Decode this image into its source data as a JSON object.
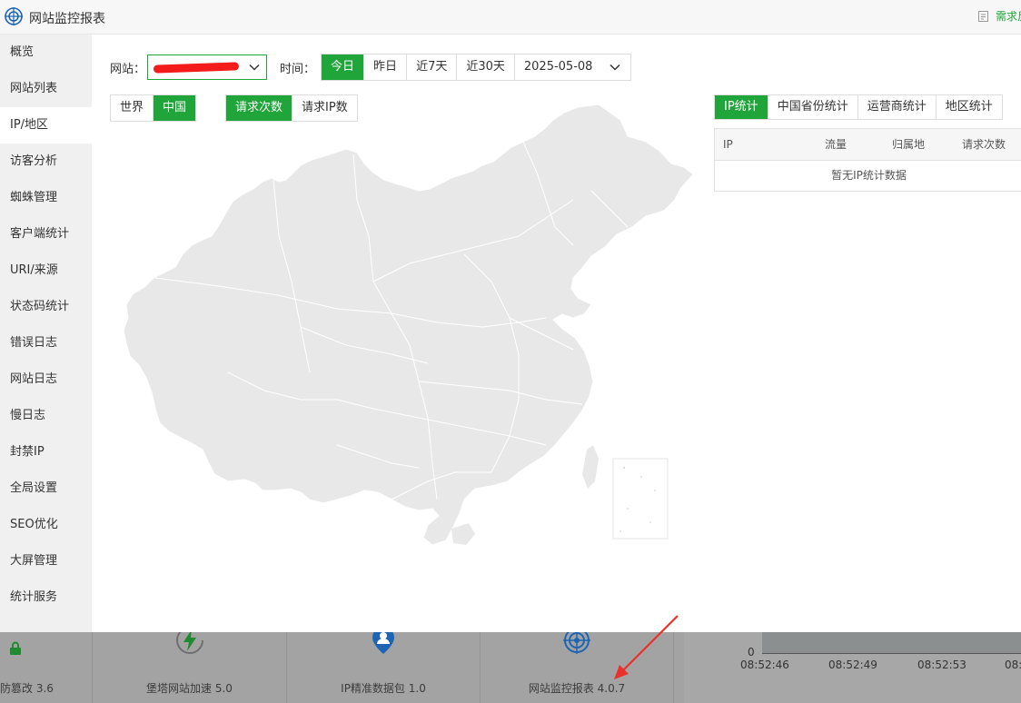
{
  "app": {
    "title": "网站监控报表",
    "request_link": "需求反"
  },
  "sidebar": {
    "items": [
      {
        "label": "概览"
      },
      {
        "label": "网站列表"
      },
      {
        "label": "IP/地区",
        "active": true
      },
      {
        "label": "访客分析"
      },
      {
        "label": "蜘蛛管理"
      },
      {
        "label": "客户端统计"
      },
      {
        "label": "URI/来源"
      },
      {
        "label": "状态码统计"
      },
      {
        "label": "错误日志"
      },
      {
        "label": "网站日志"
      },
      {
        "label": "慢日志"
      },
      {
        "label": "封禁IP"
      },
      {
        "label": "全局设置"
      },
      {
        "label": "SEO优化"
      },
      {
        "label": "大屏管理"
      },
      {
        "label": "统计服务"
      }
    ]
  },
  "filters": {
    "site_label": "网站：",
    "time_label": "时间：",
    "time_ranges": [
      "今日",
      "昨日",
      "近7天",
      "近30天"
    ],
    "active_time": "今日",
    "date": "2025-05-08"
  },
  "map_toggle": {
    "options": [
      "世界",
      "中国"
    ],
    "active": "中国"
  },
  "metric_toggle": {
    "options": [
      "请求次数",
      "请求IP数"
    ],
    "active": "请求次数"
  },
  "stat_tabs": {
    "options": [
      "IP统计",
      "中国省份统计",
      "运营商统计",
      "地区统计"
    ],
    "active": "IP统计"
  },
  "stat_table": {
    "columns": [
      "IP",
      "流量",
      "归属地",
      "请求次数"
    ],
    "empty": "暂无IP统计数据"
  },
  "background": {
    "cards": [
      {
        "label": "防篡改 3.6"
      },
      {
        "label": "堡塔网站加速 5.0"
      },
      {
        "label": "IP精准数据包 1.0"
      },
      {
        "label": "网站监控报表 4.0.7"
      }
    ],
    "chart": {
      "y_zero": "0",
      "x_ticks": [
        "08:52:46",
        "08:52:49",
        "08:52:53",
        "08:5"
      ]
    }
  },
  "colors": {
    "accent": "#20a53a",
    "map_fill": "#e8e8e8",
    "annotation": "#e8322a"
  }
}
